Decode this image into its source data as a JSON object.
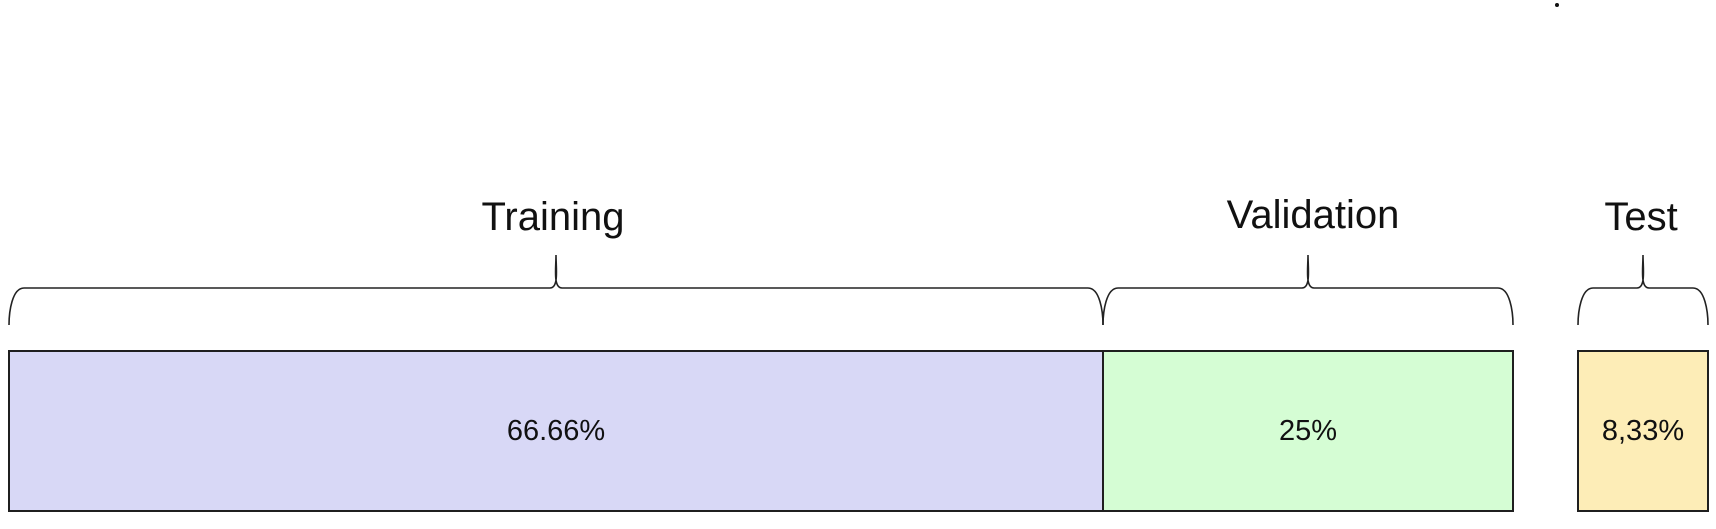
{
  "segments": [
    {
      "label": "Training",
      "value": "66.66%",
      "color": "#d8d8f6"
    },
    {
      "label": "Validation",
      "value": "25%",
      "color": "#d5fdd4"
    },
    {
      "label": "Test",
      "value": "8,33%",
      "color": "#fdedb7"
    }
  ]
}
